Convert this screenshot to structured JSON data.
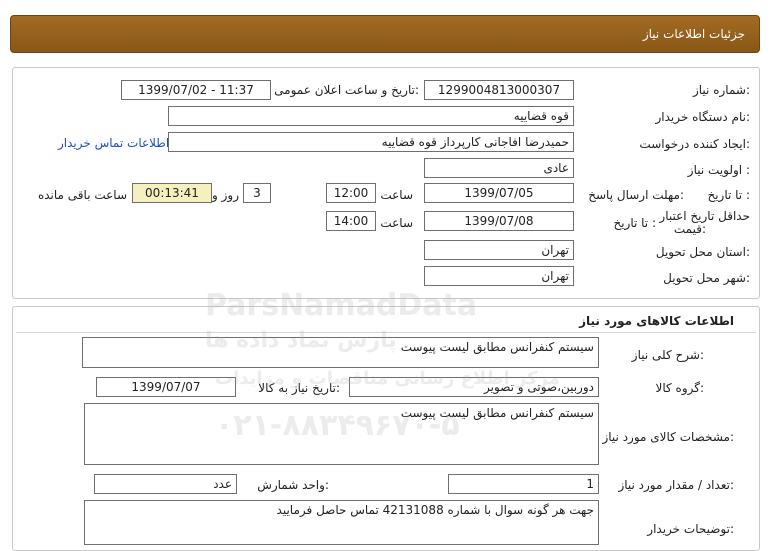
{
  "header": {
    "title": "جزئیات اطلاعات نیاز"
  },
  "info": {
    "need_number_label": "شماره نیاز:",
    "need_number": "1299004813000307",
    "announce_label": "تاریخ و ساعت اعلان عمومی:",
    "announce_value": "1399/07/02 - 11:37",
    "buyer_org_label": "نام دستگاه خریدار:",
    "buyer_org": "قوه قضاییه",
    "creator_label": "ایجاد کننده درخواست:",
    "creator": "حمیدرضا افاجانی کارپرداز قوه قضاییه",
    "contact_link": "اطلاعات تماس خریدار",
    "priority_label": "اولویت نیاز :",
    "priority": "عادی",
    "deadline_label": "مهلت ارسال پاسخ:",
    "until_label": "تا تاریخ :",
    "deadline_date": "1399/07/05",
    "time_label": "ساعت",
    "deadline_time": "12:00",
    "days": "3",
    "days_label": "روز و",
    "remaining_time": "00:13:41",
    "remaining_label": "ساعت باقی مانده",
    "validity_label_1": "حداقل تاریخ اعتبار",
    "validity_label_2": "قیمت:",
    "validity_until_label": "تا تاریخ :",
    "validity_date": "1399/07/08",
    "validity_time_label": "ساعت",
    "validity_time": "14:00",
    "province_label": "استان محل تحویل:",
    "province": "تهران",
    "city_label": "شهر محل تحویل:",
    "city": "تهران"
  },
  "goods": {
    "title": "اطلاعات کالاهای مورد نیاز",
    "desc_label": "شرح کلی نیاز:",
    "desc": "سیستم کنفرانس مطابق لیست پیوست",
    "group_label": "گروه کالا:",
    "group": "دوربین،صوتی و تصویر",
    "need_date_label": "تاریخ نیاز به کالا:",
    "need_date": "1399/07/07",
    "specs_label": "مشخصات کالای مورد نیاز:",
    "specs": "سیستم کنفرانس مطابق لیست پیوست",
    "qty_label": "تعداد / مقدار مورد نیاز:",
    "qty": "1",
    "unit_label": "واحد شمارش:",
    "unit": "عدد",
    "buyer_notes_label": "توضیحات خریدار:",
    "buyer_notes": "جهت هر گونه سوال با شماره 42131088 تماس حاصل فرمایید"
  },
  "watermark": {
    "brand": "ParsNamadData",
    "brand_fa": "پارس نماد داده ها",
    "tagline": "مرکز اطلاع رسانی مناقصات و مزایدات",
    "phone": "۰۲۱-۸۸۳۴۹۶۷۰-۵"
  }
}
